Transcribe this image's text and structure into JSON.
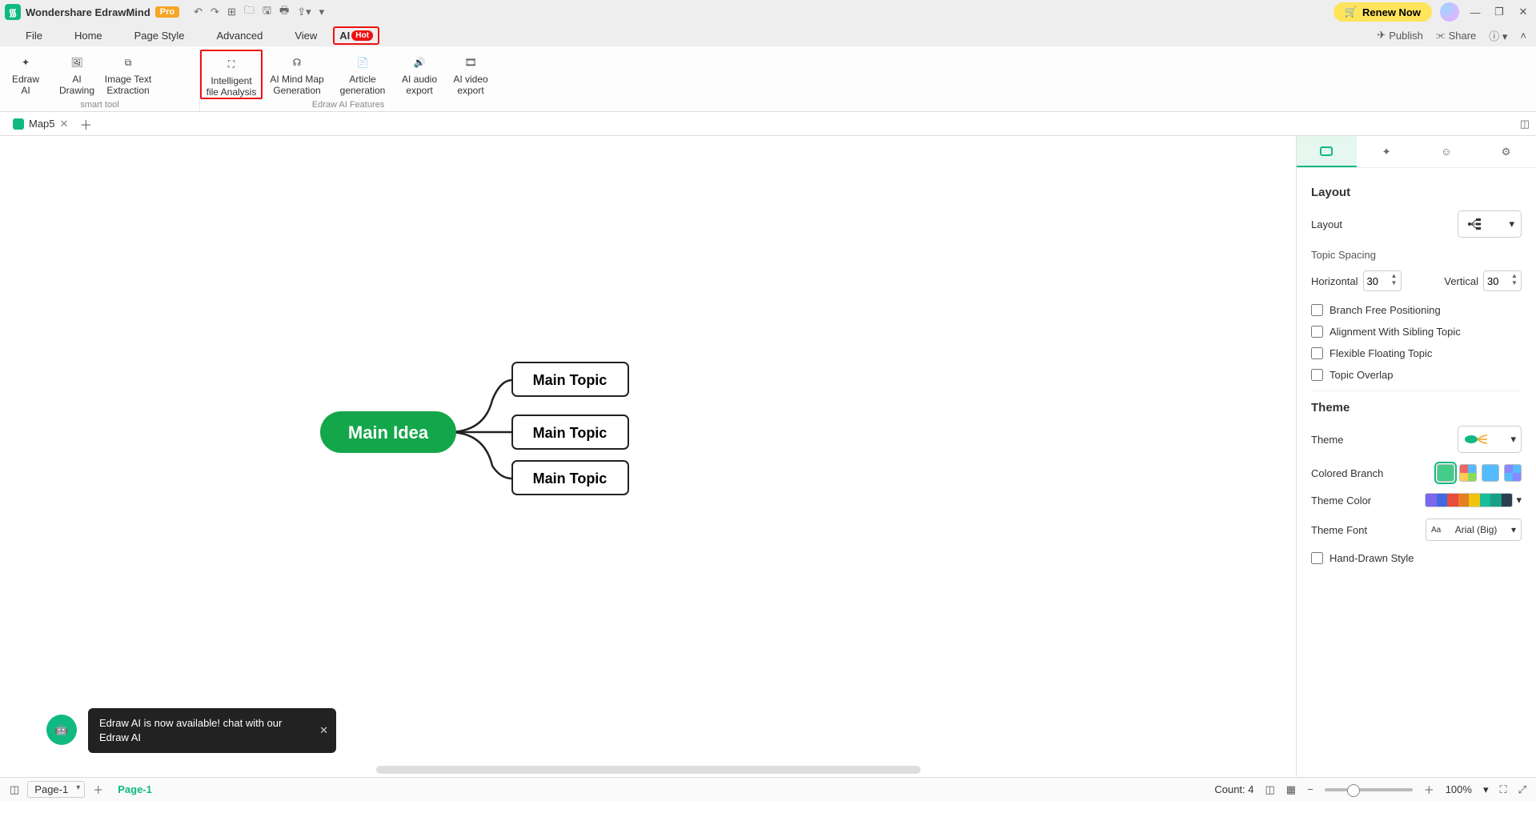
{
  "app": {
    "title": "Wondershare EdrawMind",
    "pro": "Pro",
    "renew": "Renew Now"
  },
  "menu": {
    "file": "File",
    "home": "Home",
    "pageStyle": "Page Style",
    "advanced": "Advanced",
    "view": "View",
    "ai": "AI",
    "hot": "Hot",
    "publish": "Publish",
    "share": "Share"
  },
  "ribbon": {
    "items": [
      {
        "l1": "Edraw",
        "l2": "AI"
      },
      {
        "l1": "AI",
        "l2": "Drawing"
      },
      {
        "l1": "Image Text",
        "l2": "Extraction"
      },
      {
        "l1": "Intelligent",
        "l2": "file Analysis"
      },
      {
        "l1": "AI Mind Map",
        "l2": "Generation"
      },
      {
        "l1": "Article",
        "l2": "generation"
      },
      {
        "l1": "AI audio",
        "l2": "export"
      },
      {
        "l1": "AI video",
        "l2": "export"
      }
    ],
    "group1": "smart tool",
    "group2": "Edraw AI Features"
  },
  "tab": {
    "name": "Map5"
  },
  "mindmap": {
    "center": "Main Idea",
    "topics": [
      "Main Topic",
      "Main Topic",
      "Main Topic"
    ]
  },
  "toast": "Edraw AI is now available!  chat with our Edraw AI",
  "panel": {
    "layoutTitle": "Layout",
    "layoutLabel": "Layout",
    "spacingTitle": "Topic Spacing",
    "horizontal": "Horizontal",
    "vertical": "Vertical",
    "hVal": "30",
    "vVal": "30",
    "chk1": "Branch Free Positioning",
    "chk2": "Alignment With Sibling Topic",
    "chk3": "Flexible Floating Topic",
    "chk4": "Topic Overlap",
    "themeTitle": "Theme",
    "themeLabel": "Theme",
    "coloredBranch": "Colored Branch",
    "themeColor": "Theme Color",
    "themeFont": "Theme Font",
    "fontValue": "Arial (Big)",
    "handDrawn": "Hand-Drawn Style"
  },
  "status": {
    "pageSel": "Page-1",
    "pageTab": "Page-1",
    "count": "Count: 4",
    "zoom": "100%"
  }
}
